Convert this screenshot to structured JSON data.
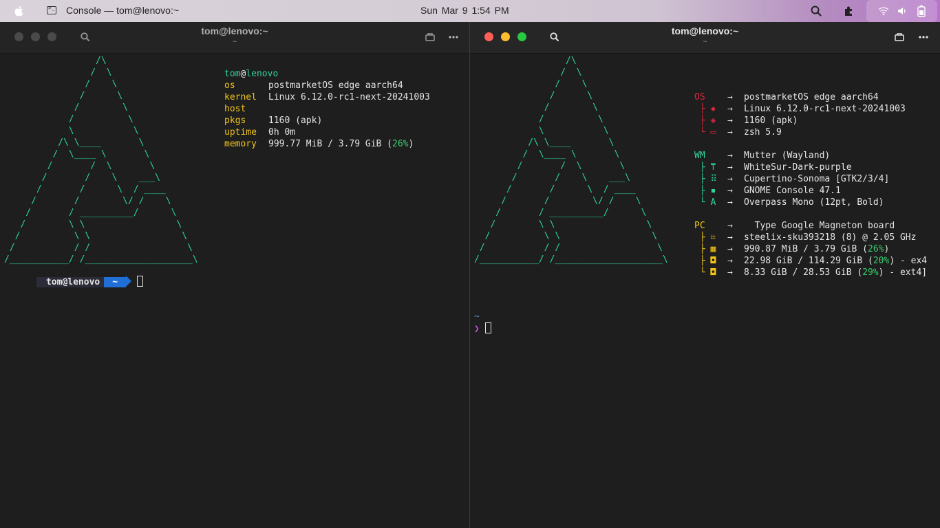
{
  "topbar": {
    "app_title": "Console  —  tom@lenovo:~",
    "clock": "Sun Mar 9   1:54 PM"
  },
  "left_window": {
    "title": "tom@lenovo:~",
    "subtitle": "~",
    "ascii_logo": [
      "                 /\\",
      "                /  \\",
      "               /    \\",
      "              /      \\",
      "             /        \\",
      "            /          \\",
      "            \\           \\",
      "          /\\ \\____       \\",
      "         /  \\____ \\       \\",
      "        /       /  \\       \\",
      "       /       /    \\    ___\\",
      "      /       /      \\  / ____",
      "     /       /        \\/ /    \\",
      "    /       / __________/      \\",
      "   /        \\ \\                 \\",
      "  /          \\ \\                 \\",
      " /           / /                  \\",
      "/___________/ /____________________\\"
    ],
    "fetch": {
      "user": "tom",
      "at": "@",
      "host": "lenovo",
      "rows": [
        {
          "key": "os",
          "value": "postmarketOS edge aarch64"
        },
        {
          "key": "kernel",
          "value": "Linux 6.12.0-rc1-next-20241003"
        },
        {
          "key": "host",
          "value": ""
        },
        {
          "key": "pkgs",
          "value": "1160 (apk)"
        },
        {
          "key": "uptime",
          "value": "0h 0m"
        },
        {
          "key": "memory",
          "value": "999.77 MiB / 3.79 GiB (",
          "pct": "26%",
          "tail": ")"
        }
      ]
    },
    "prompt": {
      "user": "tom@lenovo",
      "dir": "~"
    }
  },
  "right_window": {
    "title": "tom@lenovo:~",
    "subtitle": "~",
    "ascii_logo": [
      "                 /\\",
      "                /  \\",
      "               /    \\",
      "              /      \\",
      "             /        \\",
      "            /          \\",
      "            \\           \\",
      "          /\\ \\____       \\",
      "         /  \\____ \\       \\",
      "        /       /  \\       \\",
      "       /       /    \\    ___\\",
      "      /       /      \\  / ____",
      "     /       /        \\/ /    \\",
      "    /       / __________/      \\",
      "   /        \\ \\                 \\",
      "  /          \\ \\                 \\",
      " /           / /                  \\",
      "/___________/ /____________________\\"
    ],
    "sections": [
      {
        "label": "OS",
        "color": "#e0243a",
        "rows": [
          {
            "icon": "",
            "value": "postmarketOS edge aarch64"
          },
          {
            "icon": "✹",
            "value": "Linux 6.12.0-rc1-next-20241003"
          },
          {
            "icon": "◈",
            "value": "1160 (apk)"
          },
          {
            "icon": "▭",
            "value": "zsh 5.9"
          }
        ]
      },
      {
        "label": "WM",
        "color": "#2ed3a0",
        "rows": [
          {
            "icon": "",
            "value": "Mutter (Wayland)"
          },
          {
            "icon": "⍑",
            "value": "WhiteSur-Dark-purple"
          },
          {
            "icon": "⠿",
            "value": "Cupertino-Sonoma [GTK2/3/4]"
          },
          {
            "icon": "▪",
            "value": "GNOME Console 47.1"
          },
          {
            "icon": "A",
            "value": "Overpass Mono (12pt, Bold)"
          }
        ]
      },
      {
        "label": "PC",
        "color": "#f0c419",
        "rows": [
          {
            "icon": "",
            "value": "  Type Google Magneton board"
          },
          {
            "icon": "⌗",
            "value": "steelix-sku393218 (8) @ 2.05 GHz"
          },
          {
            "icon": "▦",
            "value": "990.87 MiB / 3.79 GiB (",
            "pct": "26%",
            "tail": ")"
          },
          {
            "icon": "◘",
            "value": "22.98 GiB / 114.29 GiB (",
            "pct": "20%",
            "tail": ") - ex4"
          },
          {
            "icon": "◘",
            "value": "8.33 GiB / 28.53 GiB (",
            "pct": "29%",
            "tail": ") - ext4]"
          }
        ]
      }
    ],
    "arrow": "→",
    "prompt_path": "~",
    "prompt_char": "❯"
  }
}
